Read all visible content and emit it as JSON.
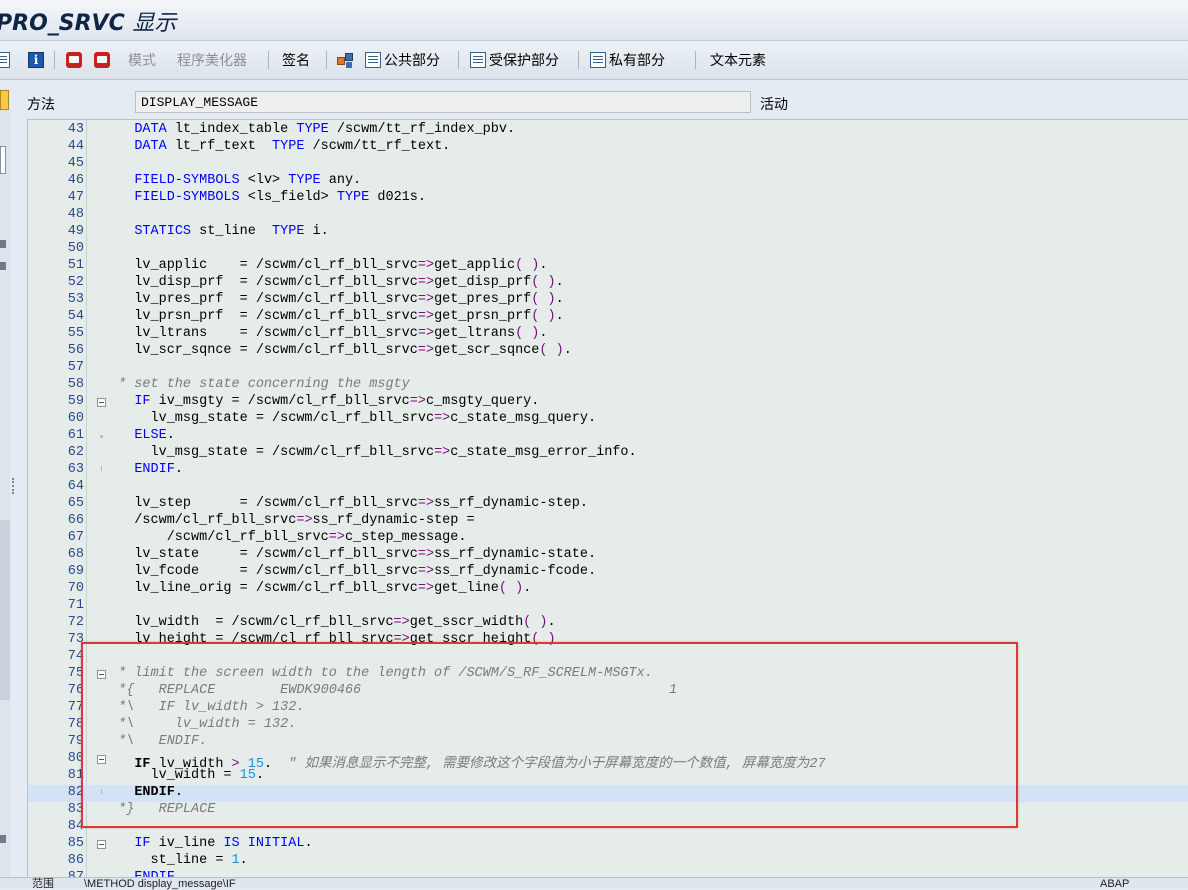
{
  "window": {
    "title_prefix": "PRO_SRVC",
    "title_suffix": "显示"
  },
  "toolbar": {
    "mode_label": "模式",
    "pretty_printer_label": "程序美化器",
    "signature_label": "签名",
    "public_section_label": "公共部分",
    "protected_section_label": "受保护部分",
    "private_section_label": "私有部分",
    "text_elements_label": "文本元素"
  },
  "method_row": {
    "label": "方法",
    "value": "DISPLAY_MESSAGE",
    "status": "活动"
  },
  "code_lines": [
    {
      "n": "43",
      "fold": "",
      "tokens": [
        [
          "",
          "   "
        ],
        [
          "kw",
          "DATA"
        ],
        [
          "",
          " lt_index_table "
        ],
        [
          "kw",
          "TYPE"
        ],
        [
          "",
          " /scwm/tt_rf_index_pbv."
        ]
      ]
    },
    {
      "n": "44",
      "fold": "",
      "tokens": [
        [
          "",
          "   "
        ],
        [
          "kw",
          "DATA"
        ],
        [
          "",
          " lt_rf_text  "
        ],
        [
          "kw",
          "TYPE"
        ],
        [
          "",
          " /scwm/tt_rf_text."
        ]
      ]
    },
    {
      "n": "45",
      "fold": "",
      "tokens": []
    },
    {
      "n": "46",
      "fold": "",
      "tokens": [
        [
          "",
          "   "
        ],
        [
          "kw",
          "FIELD-SYMBOLS"
        ],
        [
          "",
          " <lv> "
        ],
        [
          "kw",
          "TYPE"
        ],
        [
          "",
          " any."
        ]
      ]
    },
    {
      "n": "47",
      "fold": "",
      "tokens": [
        [
          "",
          "   "
        ],
        [
          "kw",
          "FIELD-SYMBOLS"
        ],
        [
          "",
          " <ls_field> "
        ],
        [
          "kw",
          "TYPE"
        ],
        [
          "",
          " d021s."
        ]
      ]
    },
    {
      "n": "48",
      "fold": "",
      "tokens": []
    },
    {
      "n": "49",
      "fold": "",
      "tokens": [
        [
          "",
          "   "
        ],
        [
          "kw",
          "STATICS"
        ],
        [
          "",
          " st_line  "
        ],
        [
          "kw",
          "TYPE"
        ],
        [
          "",
          " i."
        ]
      ]
    },
    {
      "n": "50",
      "fold": "",
      "tokens": []
    },
    {
      "n": "51",
      "fold": "",
      "tokens": [
        [
          "",
          "   lv_applic    = /scwm/cl_rf_bll_srvc"
        ],
        [
          "op",
          "=>"
        ],
        [
          "",
          "get_applic"
        ],
        [
          "op",
          "( )"
        ],
        [
          "",
          "."
        ]
      ]
    },
    {
      "n": "52",
      "fold": "",
      "tokens": [
        [
          "",
          "   lv_disp_prf  = /scwm/cl_rf_bll_srvc"
        ],
        [
          "op",
          "=>"
        ],
        [
          "",
          "get_disp_prf"
        ],
        [
          "op",
          "( )"
        ],
        [
          "",
          "."
        ]
      ]
    },
    {
      "n": "53",
      "fold": "",
      "tokens": [
        [
          "",
          "   lv_pres_prf  = /scwm/cl_rf_bll_srvc"
        ],
        [
          "op",
          "=>"
        ],
        [
          "",
          "get_pres_prf"
        ],
        [
          "op",
          "( )"
        ],
        [
          "",
          "."
        ]
      ]
    },
    {
      "n": "54",
      "fold": "",
      "tokens": [
        [
          "",
          "   lv_prsn_prf  = /scwm/cl_rf_bll_srvc"
        ],
        [
          "op",
          "=>"
        ],
        [
          "",
          "get_prsn_prf"
        ],
        [
          "op",
          "( )"
        ],
        [
          "",
          "."
        ]
      ]
    },
    {
      "n": "55",
      "fold": "",
      "tokens": [
        [
          "",
          "   lv_ltrans    = /scwm/cl_rf_bll_srvc"
        ],
        [
          "op",
          "=>"
        ],
        [
          "",
          "get_ltrans"
        ],
        [
          "op",
          "( )"
        ],
        [
          "",
          "."
        ]
      ]
    },
    {
      "n": "56",
      "fold": "",
      "tokens": [
        [
          "",
          "   lv_scr_sqnce = /scwm/cl_rf_bll_srvc"
        ],
        [
          "op",
          "=>"
        ],
        [
          "",
          "get_scr_sqnce"
        ],
        [
          "op",
          "( )"
        ],
        [
          "",
          "."
        ]
      ]
    },
    {
      "n": "57",
      "fold": "",
      "tokens": []
    },
    {
      "n": "58",
      "fold": "",
      "tokens": [
        [
          "cm",
          " * set the state concerning the msgty"
        ]
      ]
    },
    {
      "n": "59",
      "fold": "box",
      "tokens": [
        [
          "",
          "   "
        ],
        [
          "kw",
          "IF"
        ],
        [
          "",
          " iv_msgty = /scwm/cl_rf_bll_srvc"
        ],
        [
          "op",
          "=>"
        ],
        [
          "",
          "c_msgty_query."
        ]
      ]
    },
    {
      "n": "60",
      "fold": "",
      "tokens": [
        [
          "",
          "     lv_msg_state = /scwm/cl_rf_bll_srvc"
        ],
        [
          "op",
          "=>"
        ],
        [
          "",
          "c_state_msg_query."
        ]
      ]
    },
    {
      "n": "61",
      "fold": "dot",
      "tokens": [
        [
          "",
          "   "
        ],
        [
          "kw",
          "ELSE"
        ],
        [
          "",
          "."
        ]
      ]
    },
    {
      "n": "62",
      "fold": "",
      "tokens": [
        [
          "",
          "     lv_msg_state = /scwm/cl_rf_bll_srvc"
        ],
        [
          "op",
          "=>"
        ],
        [
          "",
          "c_state_msg_error_info."
        ]
      ]
    },
    {
      "n": "63",
      "fold": "end",
      "tokens": [
        [
          "",
          "   "
        ],
        [
          "kw",
          "ENDIF"
        ],
        [
          "",
          "."
        ]
      ]
    },
    {
      "n": "64",
      "fold": "",
      "tokens": []
    },
    {
      "n": "65",
      "fold": "",
      "tokens": [
        [
          "",
          "   lv_step      = /scwm/cl_rf_bll_srvc"
        ],
        [
          "op",
          "=>"
        ],
        [
          "",
          "ss_rf_dynamic-step."
        ]
      ]
    },
    {
      "n": "66",
      "fold": "",
      "tokens": [
        [
          "",
          "   /scwm/cl_rf_bll_srvc"
        ],
        [
          "op",
          "=>"
        ],
        [
          "",
          "ss_rf_dynamic-step ="
        ]
      ]
    },
    {
      "n": "67",
      "fold": "",
      "tokens": [
        [
          "",
          "       /scwm/cl_rf_bll_srvc"
        ],
        [
          "op",
          "=>"
        ],
        [
          "",
          "c_step_message."
        ]
      ]
    },
    {
      "n": "68",
      "fold": "",
      "tokens": [
        [
          "",
          "   lv_state     = /scwm/cl_rf_bll_srvc"
        ],
        [
          "op",
          "=>"
        ],
        [
          "",
          "ss_rf_dynamic-state."
        ]
      ]
    },
    {
      "n": "69",
      "fold": "",
      "tokens": [
        [
          "",
          "   lv_fcode     = /scwm/cl_rf_bll_srvc"
        ],
        [
          "op",
          "=>"
        ],
        [
          "",
          "ss_rf_dynamic-fcode."
        ]
      ]
    },
    {
      "n": "70",
      "fold": "",
      "tokens": [
        [
          "",
          "   lv_line_orig = /scwm/cl_rf_bll_srvc"
        ],
        [
          "op",
          "=>"
        ],
        [
          "",
          "get_line"
        ],
        [
          "op",
          "( )"
        ],
        [
          "",
          "."
        ]
      ]
    },
    {
      "n": "71",
      "fold": "",
      "tokens": []
    },
    {
      "n": "72",
      "fold": "",
      "tokens": [
        [
          "",
          "   lv_width  = /scwm/cl_rf_bll_srvc"
        ],
        [
          "op",
          "=>"
        ],
        [
          "",
          "get_sscr_width"
        ],
        [
          "op",
          "( )"
        ],
        [
          "",
          "."
        ]
      ]
    },
    {
      "n": "73",
      "fold": "",
      "tokens": [
        [
          "",
          "   lv_height = /scwm/cl_rf_bll_srvc"
        ],
        [
          "op",
          "=>"
        ],
        [
          "",
          "get_sscr_height"
        ],
        [
          "op",
          "( )"
        ]
      ]
    },
    {
      "n": "74",
      "fold": "",
      "tokens": []
    },
    {
      "n": "75",
      "fold": "box",
      "tokens": [
        [
          "cm",
          " * limit the screen width to the length of /SCWM/S_RF_SCRELM-MSGTx."
        ]
      ]
    },
    {
      "n": "76",
      "fold": "",
      "tokens": [
        [
          "cm",
          " *{   REPLACE        EWDK900466                                      1"
        ]
      ]
    },
    {
      "n": "77",
      "fold": "",
      "tokens": [
        [
          "cm",
          " *\\   IF lv_width > 132."
        ]
      ]
    },
    {
      "n": "78",
      "fold": "",
      "tokens": [
        [
          "cm",
          " *\\     lv_width = 132."
        ]
      ]
    },
    {
      "n": "79",
      "fold": "",
      "tokens": [
        [
          "cm",
          " *\\   ENDIF."
        ]
      ]
    },
    {
      "n": "80",
      "fold": "box",
      "tokens": [
        [
          "",
          "   "
        ],
        [
          "bold",
          "IF"
        ],
        [
          "",
          " lv_width "
        ],
        [
          "op",
          ">"
        ],
        [
          "",
          " "
        ],
        [
          "num",
          "15"
        ],
        [
          "",
          "."
        ],
        [
          "cm",
          "  \" 如果消息显示不完整, 需要修改这个字段值为小于屏幕宽度的一个数值, 屏幕宽度为27"
        ]
      ]
    },
    {
      "n": "81",
      "fold": "",
      "tokens": [
        [
          "",
          "     lv_width = "
        ],
        [
          "num",
          "15"
        ],
        [
          "",
          "."
        ]
      ]
    },
    {
      "n": "82",
      "fold": "end",
      "hl": true,
      "tokens": [
        [
          "",
          "   "
        ],
        [
          "bold",
          "ENDIF"
        ],
        [
          "",
          "."
        ]
      ]
    },
    {
      "n": "83",
      "fold": "",
      "tokens": [
        [
          "cm",
          " *}   REPLACE"
        ]
      ]
    },
    {
      "n": "84",
      "fold": "",
      "tokens": []
    },
    {
      "n": "85",
      "fold": "box",
      "tokens": [
        [
          "",
          "   "
        ],
        [
          "kw",
          "IF"
        ],
        [
          "",
          " iv_line "
        ],
        [
          "kw",
          "IS INITIAL"
        ],
        [
          "",
          "."
        ]
      ]
    },
    {
      "n": "86",
      "fold": "",
      "tokens": [
        [
          "",
          "     st_line = "
        ],
        [
          "num",
          "1"
        ],
        [
          "",
          "."
        ]
      ]
    },
    {
      "n": "87",
      "fold": "",
      "tokens": [
        [
          "",
          "   "
        ],
        [
          "kw",
          "ENDIF"
        ],
        [
          "",
          "."
        ]
      ]
    }
  ],
  "statusbar": {
    "left": "范围",
    "middle": "\\METHOD display_message\\IF",
    "right": "ABAP"
  }
}
